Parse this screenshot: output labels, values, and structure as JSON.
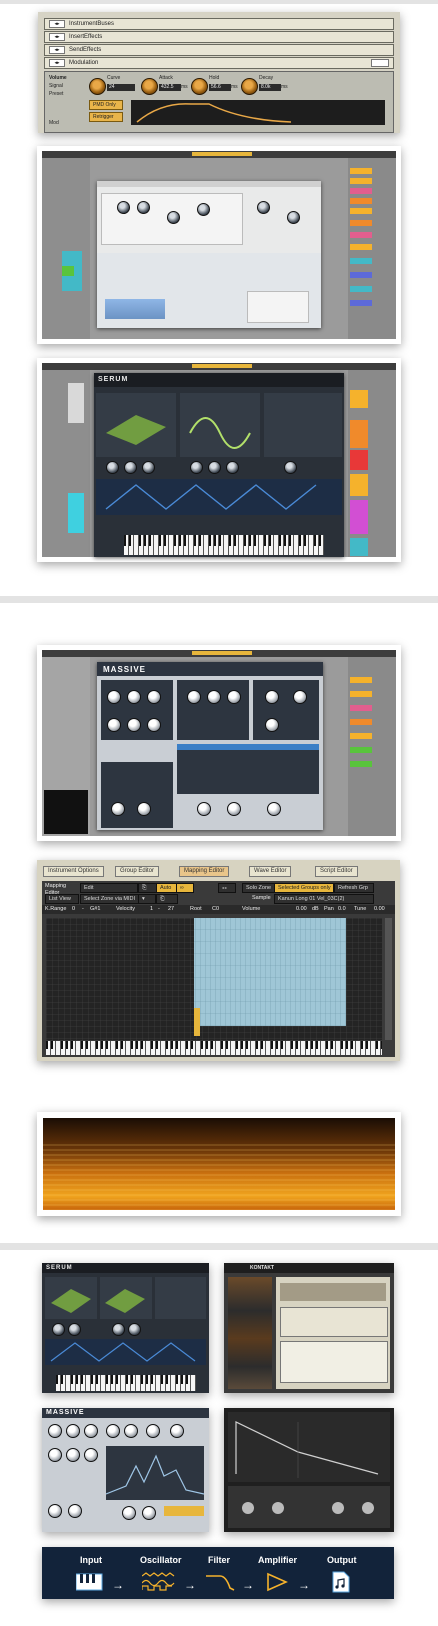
{
  "kontakt_instrument": {
    "rows": [
      "InstrumentBuses",
      "InsertEffects",
      "SendEffects",
      "Modulation"
    ],
    "labels": {
      "volume": "Volume",
      "signal": "Signal",
      "preset": "Preset",
      "mod": "Mod"
    },
    "knobs": [
      {
        "label": "Curve",
        "value": "24"
      },
      {
        "label": "Attack",
        "value": "432.5"
      },
      {
        "label": "Hold",
        "value": "56.6"
      },
      {
        "label": "Decay",
        "value": "8.0k"
      }
    ],
    "units": {
      "attack": "ms",
      "hold": "ms",
      "decay": "ms"
    },
    "buttons": [
      "PMD Only",
      "Retrigger"
    ]
  },
  "mapping_editor": {
    "tabs": [
      "Instrument Options",
      "Group Editor",
      "Mapping Editor",
      "Wave Editor",
      "Script Editor"
    ],
    "active_tab": "Mapping Editor",
    "header": {
      "title_line1": "Mapping",
      "title_line2": "Editor",
      "edit_menu": "Edit",
      "auto": "Auto",
      "solo_zone": "Solo Zone",
      "selected_groups_only": "Selected Groups only",
      "refresh": "Refresh Grp",
      "list_view": "List View",
      "select_zone": "Select Zone via MIDI",
      "sample_label": "Sample",
      "sample_value": "Kanun Long 01 Vel_03C(2)"
    },
    "params": {
      "key_range_label": "K.Range",
      "key_range_from": "0",
      "key_range_to": "G#1",
      "velocity_label": "Velocity",
      "velocity_from": "1",
      "velocity_to": "27",
      "root_label": "Root",
      "root_value": "C0",
      "volume_label": "Volume",
      "volume_value": "0.00",
      "volume_unit": "dB",
      "pan_label": "Pan",
      "pan_value": "0.0",
      "tune_label": "Tune",
      "tune_value": "0.00"
    }
  },
  "plugins": {
    "serum_logo": "SERUM",
    "massive_logo": "MASSIVE",
    "kontakt_logo": "KONTAKT"
  },
  "flow": {
    "steps": [
      "Input",
      "Oscillator",
      "Filter",
      "Amplifier",
      "Output"
    ],
    "icon_names": [
      "piano-keys-icon",
      "waveforms-icon",
      "filter-curve-icon",
      "amplifier-triangle-icon",
      "audio-file-icon"
    ]
  },
  "colors": {
    "separator": "#e3e3e3",
    "kontakt_orange": "#e9a847",
    "mapping_zone": "#9fc6d6",
    "flow_bg": "#12233a"
  }
}
